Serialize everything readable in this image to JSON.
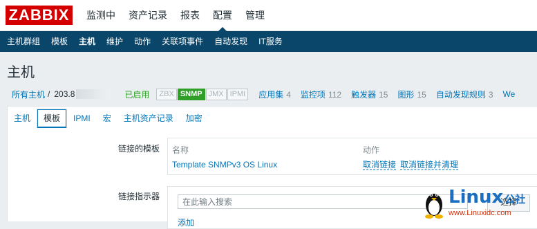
{
  "app": {
    "logo": "ZABBIX"
  },
  "top_menu": [
    {
      "label": "监测中"
    },
    {
      "label": "资产记录"
    },
    {
      "label": "报表"
    },
    {
      "label": "配置"
    },
    {
      "label": "管理"
    }
  ],
  "sub_menu": [
    {
      "label": "主机群组"
    },
    {
      "label": "模板"
    },
    {
      "label": "主机"
    },
    {
      "label": "维护"
    },
    {
      "label": "动作"
    },
    {
      "label": "关联项事件"
    },
    {
      "label": "自动发现"
    },
    {
      "label": "IT服务"
    }
  ],
  "page": {
    "title": "主机"
  },
  "breadcrumb": {
    "all_hosts": "所有主机",
    "separator": "/",
    "host_ip_prefix": "203.8",
    "status": "已启用",
    "availability": [
      "ZBX",
      "SNMP",
      "JMX",
      "IPMI"
    ],
    "stats": [
      {
        "label": "应用集",
        "count": "4"
      },
      {
        "label": "监控项",
        "count": "112"
      },
      {
        "label": "触发器",
        "count": "15"
      },
      {
        "label": "图形",
        "count": "15"
      },
      {
        "label": "自动发现规则",
        "count": "3"
      },
      {
        "label": "We",
        "count": ""
      }
    ]
  },
  "tabs": [
    {
      "label": "主机"
    },
    {
      "label": "模板"
    },
    {
      "label": "IPMI"
    },
    {
      "label": "宏"
    },
    {
      "label": "主机资产记录"
    },
    {
      "label": "加密"
    }
  ],
  "form": {
    "linked_templates_label": "链接的模板",
    "col_name": "名称",
    "col_action": "动作",
    "template_name": "Template SNMPv3 OS Linux",
    "unlink": "取消链接",
    "unlink_clear": "取消链接并清理",
    "link_new_label": "链接指示器",
    "search_placeholder": "在此输入搜索",
    "select_button": "选择",
    "add_link": "添加"
  },
  "watermark": {
    "brand": "Linux",
    "brand_cn": "公社",
    "url": "www.Linuxidc.com"
  },
  "colors": {
    "brand_red": "#d40000",
    "nav_blue": "#0a466a",
    "link": "#0275b8",
    "enabled_green": "#2f9f28"
  }
}
